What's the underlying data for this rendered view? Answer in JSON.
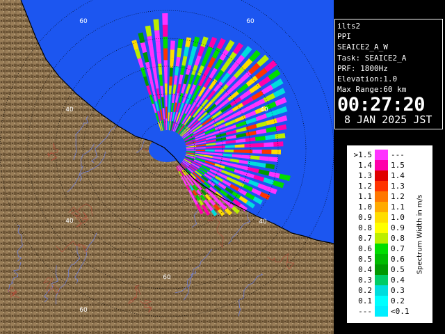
{
  "info": {
    "lines": [
      "ilts2",
      "PPI",
      "SEAICE2_A_W",
      "Task: SEAICE2_A",
      "PRF: 1800Hz",
      "Elevation:1.0",
      "Max Range:60 km"
    ],
    "time": "00:27:20",
    "date": "8 JAN 2025 JST"
  },
  "map": {
    "range_labels": [
      "60",
      "60",
      "40",
      "40",
      "40",
      "40",
      "60",
      "60"
    ],
    "colors": {
      "sea": "#1c56f0",
      "land": "#8c7250",
      "coastline": "#000000",
      "range_rings": "#000000",
      "rivers": "#7080d8",
      "boundaries": "#b0503a"
    }
  },
  "legend": {
    "title": "Spectrum Width in m/s",
    "rows": [
      {
        "left": ">1.5",
        "right": "---",
        "color": "#ff33ff"
      },
      {
        "left": "1.4",
        "right": "1.5",
        "color": "#ff00aa"
      },
      {
        "left": "1.3",
        "right": "1.4",
        "color": "#e00000"
      },
      {
        "left": "1.2",
        "right": "1.3",
        "color": "#ff3300"
      },
      {
        "left": "1.1",
        "right": "1.2",
        "color": "#ff7700"
      },
      {
        "left": "1.0",
        "right": "1.1",
        "color": "#ffaa00"
      },
      {
        "left": "0.9",
        "right": "1.0",
        "color": "#ffdd00"
      },
      {
        "left": "0.8",
        "right": "0.9",
        "color": "#ffff00"
      },
      {
        "left": "0.7",
        "right": "0.8",
        "color": "#bbee00"
      },
      {
        "left": "0.6",
        "right": "0.7",
        "color": "#00dd00"
      },
      {
        "left": "0.5",
        "right": "0.6",
        "color": "#00bb00"
      },
      {
        "left": "0.4",
        "right": "0.5",
        "color": "#009900"
      },
      {
        "left": "0.3",
        "right": "0.4",
        "color": "#00cc66"
      },
      {
        "left": "0.2",
        "right": "0.3",
        "color": "#00dddd"
      },
      {
        "left": "0.1",
        "right": "0.2",
        "color": "#00ffff"
      },
      {
        "left": "---",
        "right": "<0.1",
        "color": "#00eeff"
      }
    ]
  }
}
